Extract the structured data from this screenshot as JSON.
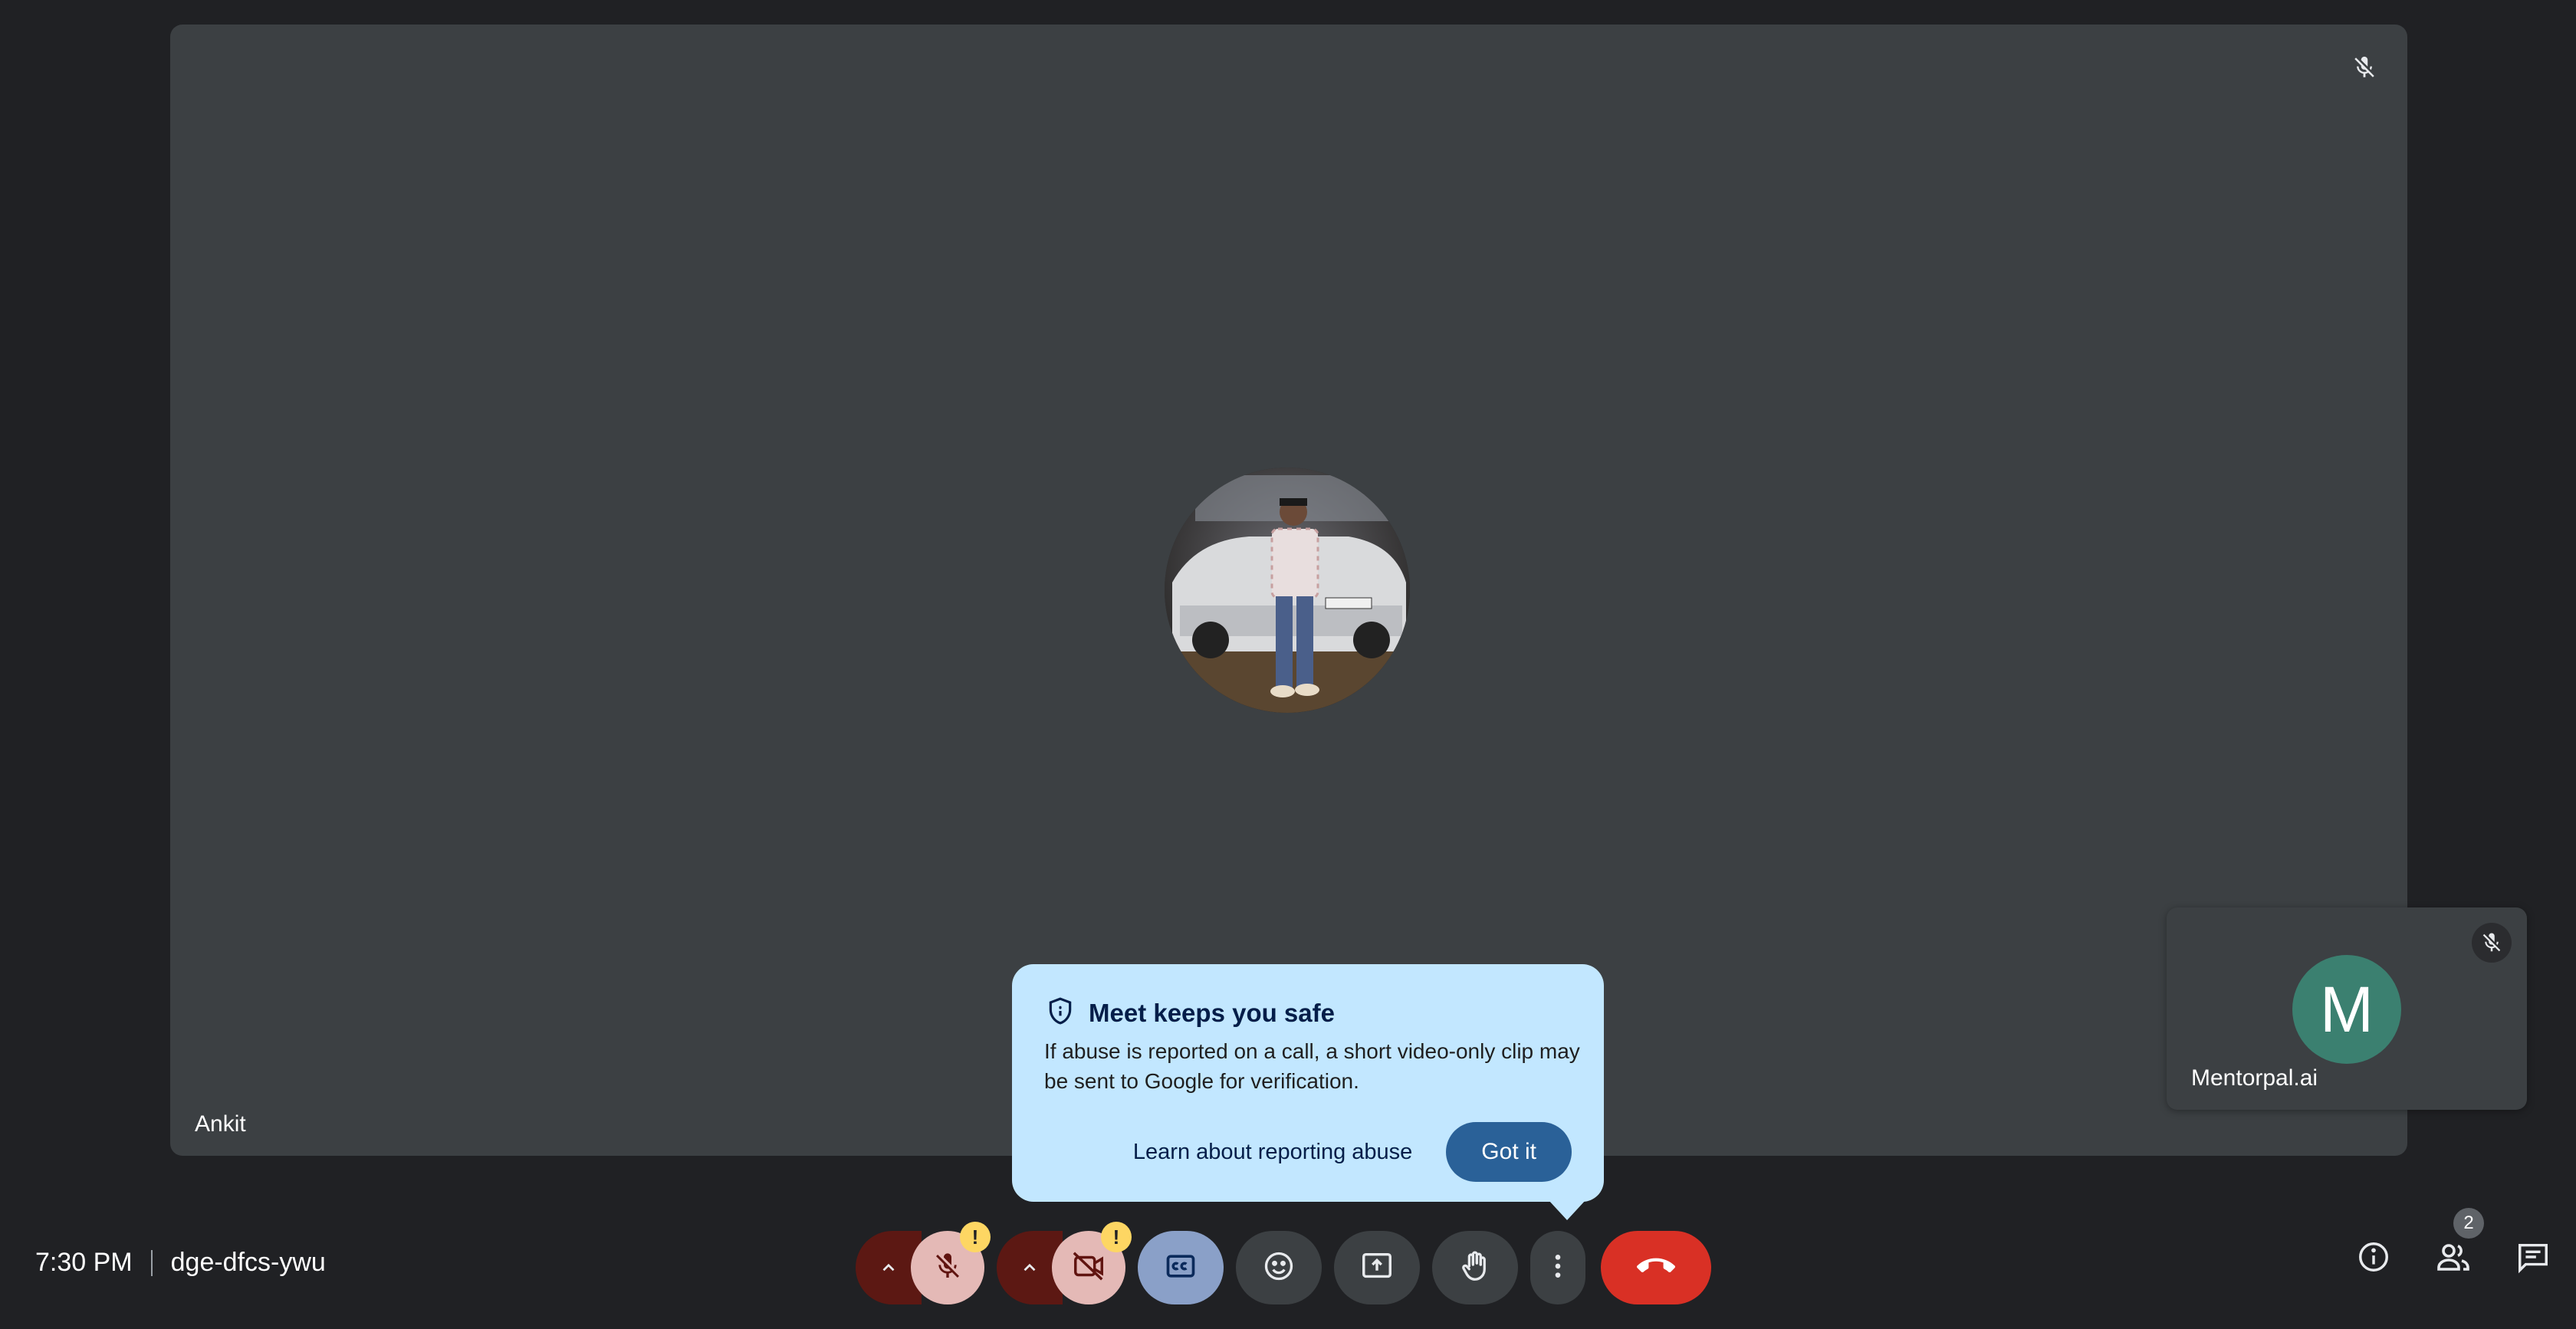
{
  "meeting": {
    "time": "7:30 PM",
    "code": "dge-dfcs-ywu"
  },
  "main_tile": {
    "participant_name": "Ankit",
    "mic_icon": "mic-off-icon"
  },
  "self_tile": {
    "initial": "M",
    "participant_name": "Mentorpal.ai",
    "avatar_color": "#3b8070"
  },
  "popup": {
    "title": "Meet keeps you safe",
    "body": "If abuse is reported on a call, a short video-only clip may be sent to Google for verification.",
    "learn_link": "Learn about reporting abuse",
    "confirm_label": "Got it",
    "icon": "shield-icon"
  },
  "controls": {
    "mic_warning": "!",
    "camera_warning": "!",
    "items": [
      "mic-off",
      "camera-off",
      "captions",
      "emoji",
      "present",
      "raise-hand",
      "more-options",
      "leave-call"
    ]
  },
  "right_tools": {
    "people_count": "2",
    "items": [
      "info",
      "people",
      "chat"
    ]
  },
  "colors": {
    "background": "#202124",
    "tile": "#3c4043",
    "popup": "#c2e7ff",
    "primary_button": "#2a6198",
    "end_call": "#d93025",
    "warning": "#fdd663"
  }
}
